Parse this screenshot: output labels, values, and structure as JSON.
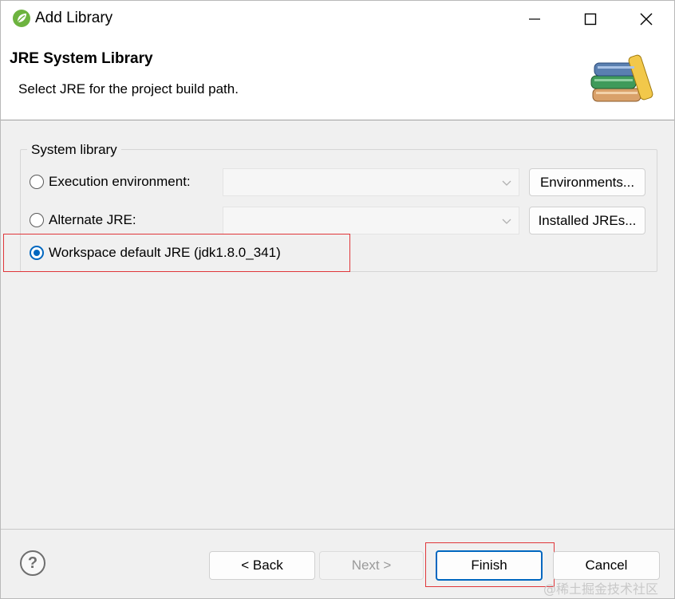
{
  "window": {
    "title": "Add Library",
    "controls": [
      "minimize-icon",
      "maximize-icon",
      "close-icon"
    ]
  },
  "banner": {
    "title": "JRE System Library",
    "description": "Select JRE for the project build path.",
    "image": "books-icon"
  },
  "group": {
    "title": "System library",
    "options": [
      {
        "label": "Execution environment:",
        "selected": false,
        "combo_value": "",
        "button": "Environments..."
      },
      {
        "label": "Alternate JRE:",
        "selected": false,
        "combo_value": "",
        "button": "Installed JREs..."
      },
      {
        "label": "Workspace default JRE (jdk1.8.0_341)",
        "selected": true
      }
    ]
  },
  "footer": {
    "help_icon": "help-icon",
    "help_glyph": "?",
    "back": "< Back",
    "next": "Next >",
    "finish": "Finish",
    "cancel": "Cancel"
  },
  "watermark": "@稀土掘金技术社区",
  "colors": {
    "accent": "#0067c0",
    "highlight": "#e0363a",
    "background": "#f0f0f0"
  }
}
